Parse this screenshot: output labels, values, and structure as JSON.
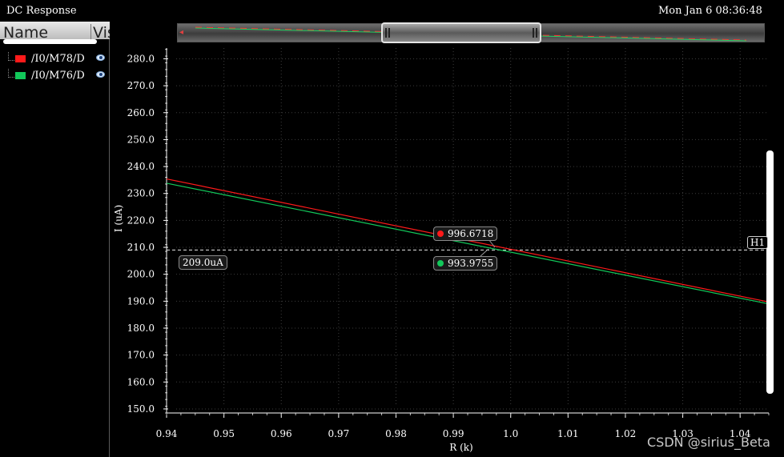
{
  "window": {
    "title": "DC Response",
    "datetime": "Mon Jan 6 08:36:48"
  },
  "sidebar": {
    "columns": {
      "name": "Name",
      "vis": "Vis"
    },
    "traces": [
      {
        "label": "/I0/M78/D",
        "color": "#ff1a1a"
      },
      {
        "label": "/I0/M76/D",
        "color": "#12c85a"
      }
    ]
  },
  "marker": {
    "name": "H1",
    "value_label": "209.0uA",
    "value": 209.0
  },
  "annotations": [
    {
      "text": "996.6718",
      "color": "#ff1a1a"
    },
    {
      "text": "993.9755",
      "color": "#12c85a"
    }
  ],
  "watermark": "CSDN @sirius_Beta",
  "chart_data": {
    "type": "line",
    "xlabel": "R (k)",
    "ylabel": "I (uA)",
    "xlim": [
      0.94,
      1.045
    ],
    "ylim": [
      148.5,
      284.0
    ],
    "x_ticks": [
      "0.94",
      "0.95",
      "0.96",
      "0.97",
      "0.98",
      "0.99",
      "1.0",
      "1.01",
      "1.02",
      "1.03",
      "1.04"
    ],
    "y_ticks": [
      "150.0",
      "160.0",
      "170.0",
      "180.0",
      "190.0",
      "200.0",
      "210.0",
      "220.0",
      "230.0",
      "240.0",
      "250.0",
      "260.0",
      "270.0",
      "280.0"
    ],
    "grid": true,
    "series": [
      {
        "name": "/I0/M78/D",
        "x": [
          0.94,
          1.045
        ],
        "y": [
          235.4,
          189.7
        ]
      },
      {
        "name": "/I0/M76/D",
        "x": [
          0.94,
          1.045
        ],
        "y": [
          233.8,
          189.0
        ]
      }
    ]
  }
}
